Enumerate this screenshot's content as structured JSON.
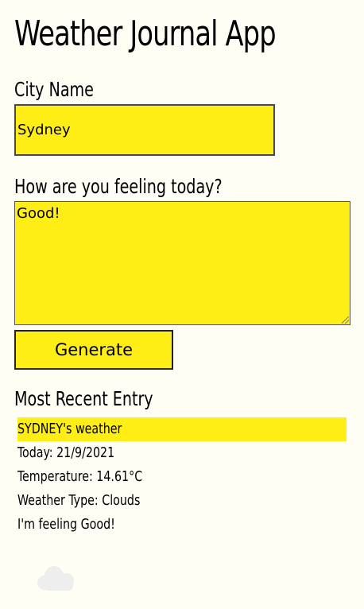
{
  "app": {
    "title": "Weather Journal App"
  },
  "form": {
    "city_label": "City Name",
    "city_value": "Sydney",
    "feeling_label": "How are you feeling today?",
    "feeling_value": "Good!",
    "generate_label": "Generate"
  },
  "recent": {
    "heading": "Most Recent Entry",
    "city_line": "SYDNEY's weather",
    "date_line": "Today: 21/9/2021",
    "temp_line": "Temperature: 14.61°C",
    "type_line": "Weather Type: Clouds",
    "feeling_line": "I'm feeling Good!"
  },
  "icons": {
    "weather_icon": "cloud-icon"
  },
  "colors": {
    "accent": "#ffee15",
    "background": "#fffef5",
    "cloud": "#eeeeee"
  }
}
